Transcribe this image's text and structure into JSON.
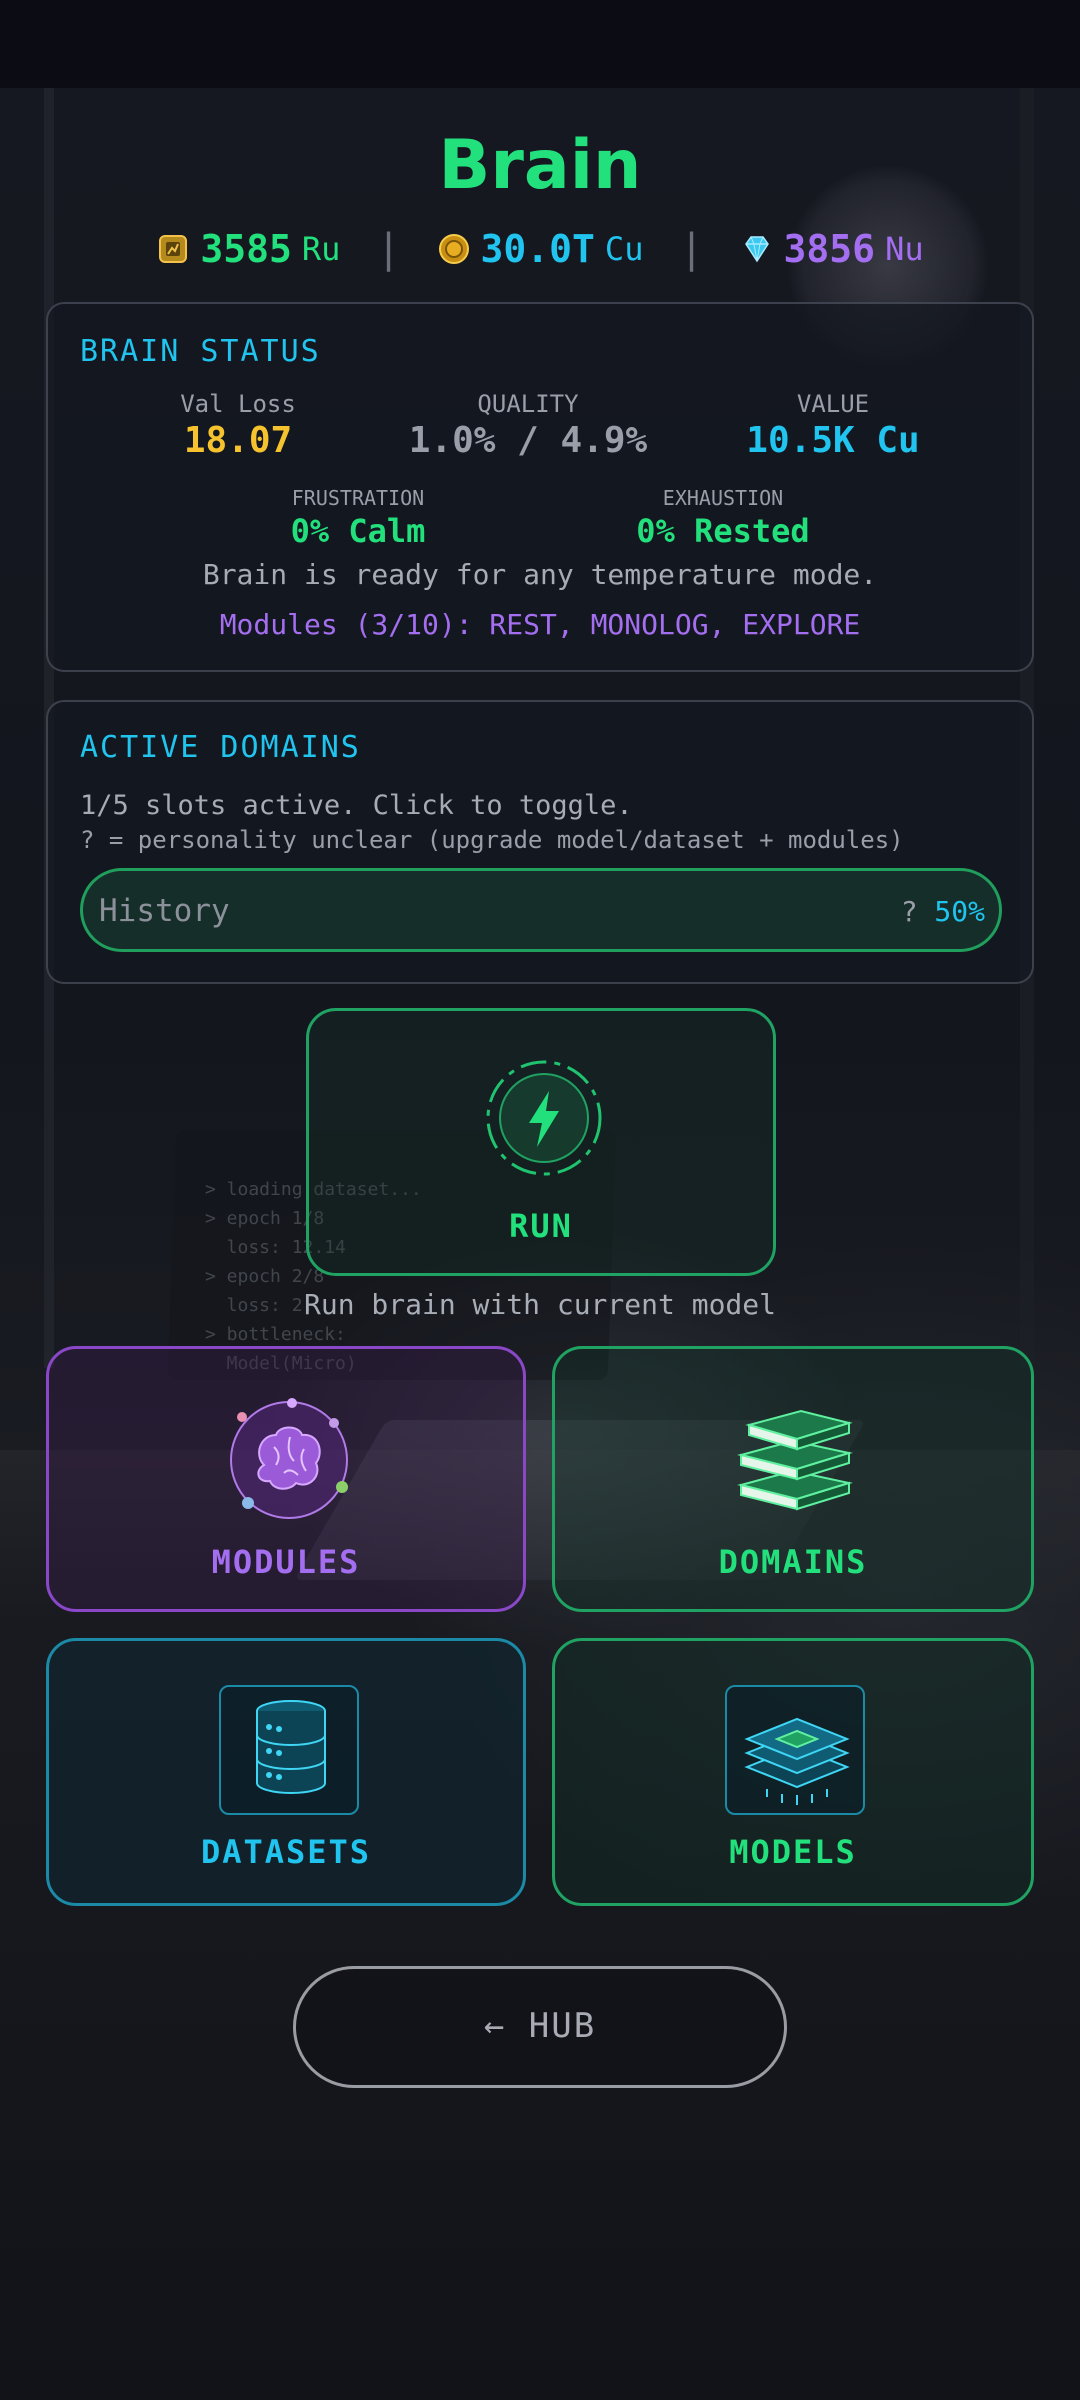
{
  "header": {
    "title": "Brain",
    "currencies": [
      {
        "value": "3585",
        "unit": "Ru",
        "color": "#22e07c",
        "icon": "chip-icon"
      },
      {
        "value": "30.0T",
        "unit": "Cu",
        "color": "#20c4ee",
        "icon": "coin-icon"
      },
      {
        "value": "3856",
        "unit": "Nu",
        "color": "#a46ef0",
        "icon": "diamond-icon"
      }
    ],
    "separator": "|"
  },
  "status": {
    "title": "BRAIN STATUS",
    "val_loss_label": "Val Loss",
    "val_loss": "18.07",
    "quality_label": "QUALITY",
    "quality": "1.0% / 4.9%",
    "value_label": "VALUE",
    "value": "10.5K Cu",
    "frustration_label": "FRUSTRATION",
    "frustration": "0% Calm",
    "exhaustion_label": "EXHAUSTION",
    "exhaustion": "0% Rested",
    "message": "Brain is ready for any temperature mode.",
    "modules": "Modules (3/10): REST, MONOLOG, EXPLORE"
  },
  "domains": {
    "title": "ACTIVE DOMAINS",
    "slots_text": "1/5 slots active. Click to toggle.",
    "hint": "? = personality unclear (upgrade model/dataset + modules)",
    "items": [
      {
        "name": "History",
        "flag": "?",
        "percent": "50%"
      }
    ]
  },
  "run": {
    "label": "RUN",
    "caption": "Run brain with current model"
  },
  "nav": {
    "modules": "MODULES",
    "domains": "DOMAINS",
    "datasets": "DATASETS",
    "models": "MODELS"
  },
  "hub": {
    "label": "← HUB"
  },
  "colors": {
    "green": "#22e07c",
    "cyan": "#20c4ee",
    "purple": "#a46ef0",
    "yellow": "#f6c22e",
    "gray": "#9a9ea8"
  }
}
